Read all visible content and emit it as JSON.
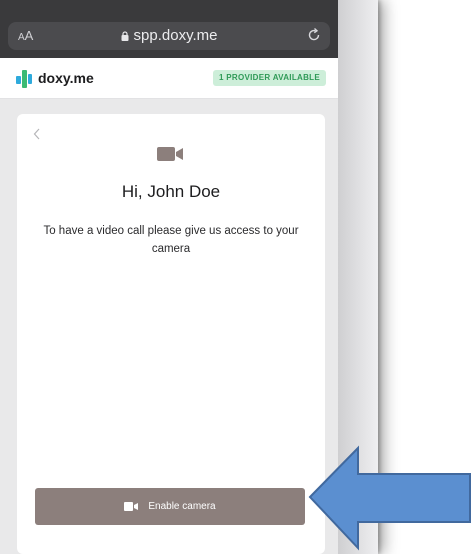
{
  "browser": {
    "text_size_label_small": "A",
    "text_size_label_large": "A",
    "url": "spp.doxy.me",
    "icons": [
      "lock-icon",
      "reload-icon"
    ]
  },
  "site": {
    "logo_text": "doxy.me",
    "provider_badge": "1 PROVIDER AVAILABLE"
  },
  "card": {
    "greeting": "Hi, John Doe",
    "message": "To have a video call please give us access to your camera",
    "enable_button_label": "Enable camera",
    "icons": [
      "back-icon",
      "video-camera-icon"
    ]
  },
  "colors": {
    "brand_blue": "#2eaadc",
    "brand_green": "#3cba74",
    "button": "#8c7f7c",
    "badge_bg": "#cdeed9",
    "badge_text": "#2f9a57",
    "arrow_fill": "#5b8fd0"
  }
}
